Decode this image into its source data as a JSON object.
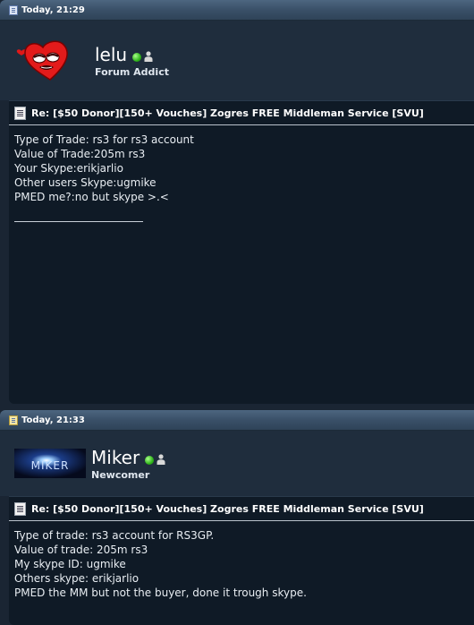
{
  "posts": [
    {
      "date": "Today, 21:29",
      "username": "lelu",
      "rank": "Forum Addict",
      "avatar": "red-heart-face",
      "subject": "Re: [$50 Donor][150+ Vouches] Zogres FREE Middleman Service [SVU]",
      "lines": [
        "Type of Trade: rs3 for rs3 account",
        "Value of Trade:205m rs3",
        "Your Skype:erikjarlio",
        "Other users Skype:ugmike",
        "PMED me?:no but skype >.<"
      ]
    },
    {
      "date": "Today, 21:33",
      "username": "Miker",
      "rank": "Newcomer",
      "avatar": "miker-logo",
      "avatar_text": "MIKER",
      "subject": "Re: [$50 Donor][150+ Vouches] Zogres FREE Middleman Service [SVU]",
      "lines": [
        "Type of trade: rs3 account for RS3GP.",
        "Value of trade: 205m rs3",
        "My skype ID: ugmike",
        "Others skype: erikjarlio",
        "PMED the MM but not the buyer, done it trough skype."
      ]
    }
  ],
  "colors": {
    "header": "#3a5068",
    "content_bg": "#0f1a26",
    "user_bg": "#1f2d3d",
    "online": "#2fb41a"
  }
}
